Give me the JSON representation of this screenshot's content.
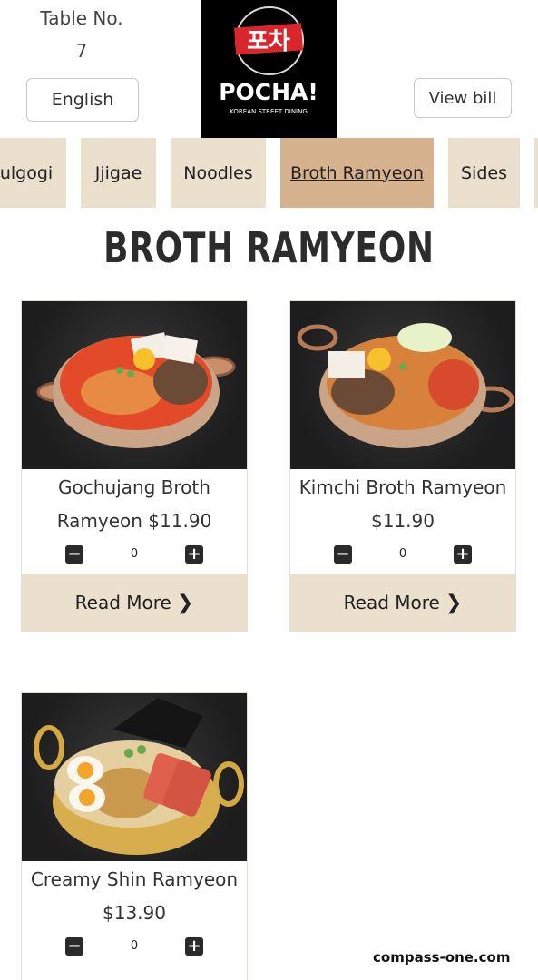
{
  "header": {
    "table_label": "Table No.",
    "table_number": "7",
    "language_button": "English",
    "view_bill_button": "View bill",
    "logo": {
      "korean_text": "포차",
      "brand": "POCHA!",
      "tagline": "KOREAN STREET DINING"
    }
  },
  "category_tabs": [
    {
      "label": "Bulgogi",
      "active": false
    },
    {
      "label": "Jjigae",
      "active": false
    },
    {
      "label": "Noodles",
      "active": false
    },
    {
      "label": "Broth Ramyeon",
      "active": true
    },
    {
      "label": "Sides",
      "active": false
    }
  ],
  "section_title": "BROTH RAMYEON",
  "menu_items": [
    {
      "name_line1": "Gochujang Broth",
      "name_line2": "Ramyeon $11.90",
      "quantity": "0",
      "read_more": "Read More"
    },
    {
      "name_line1": "Kimchi Broth Ramyeon",
      "name_line2": "$11.90",
      "quantity": "0",
      "read_more": "Read More"
    },
    {
      "name_line1": "Creamy Shin Ramyeon",
      "name_line2": "$13.90",
      "quantity": "0"
    }
  ],
  "watermark": "compass-one.com",
  "colors": {
    "tab_bg": "#ebdfcd",
    "tab_active_bg": "#d6b38e",
    "logo_red": "#d9262c"
  }
}
